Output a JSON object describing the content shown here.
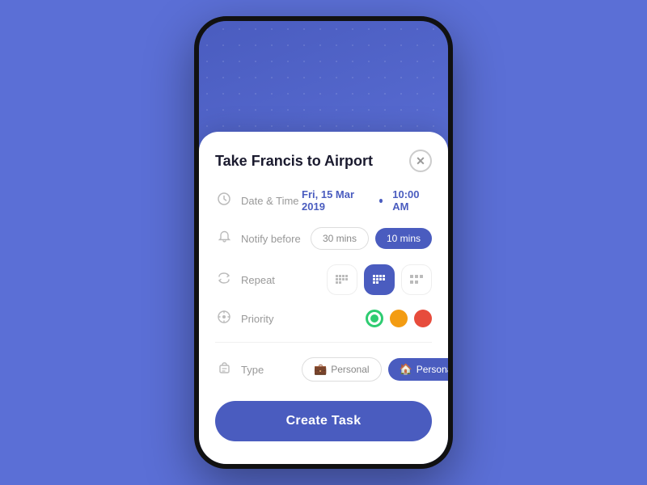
{
  "background": {
    "color": "#5b6fd6"
  },
  "modal": {
    "title": "Take Francis to Airport",
    "close_label": "×",
    "rows": {
      "datetime": {
        "label": "Date & Time",
        "date": "Fri, 15 Mar 2019",
        "time": "10:00 AM"
      },
      "notify": {
        "label": "Notify before",
        "options": [
          {
            "label": "30 mins",
            "active": false
          },
          {
            "label": "10 mins",
            "active": true
          }
        ]
      },
      "repeat": {
        "label": "Repeat",
        "options": [
          {
            "key": "weekly",
            "active": false
          },
          {
            "key": "daily",
            "active": true
          },
          {
            "key": "monthly",
            "active": false
          }
        ]
      },
      "priority": {
        "label": "Priority",
        "options": [
          {
            "color": "green",
            "selected": true
          },
          {
            "color": "orange",
            "selected": false
          },
          {
            "color": "red",
            "selected": false
          }
        ]
      },
      "type": {
        "label": "Type",
        "options": [
          {
            "label": "Personal",
            "active": false
          },
          {
            "label": "Personal",
            "active": true
          }
        ]
      }
    },
    "create_button": "Create Task"
  }
}
